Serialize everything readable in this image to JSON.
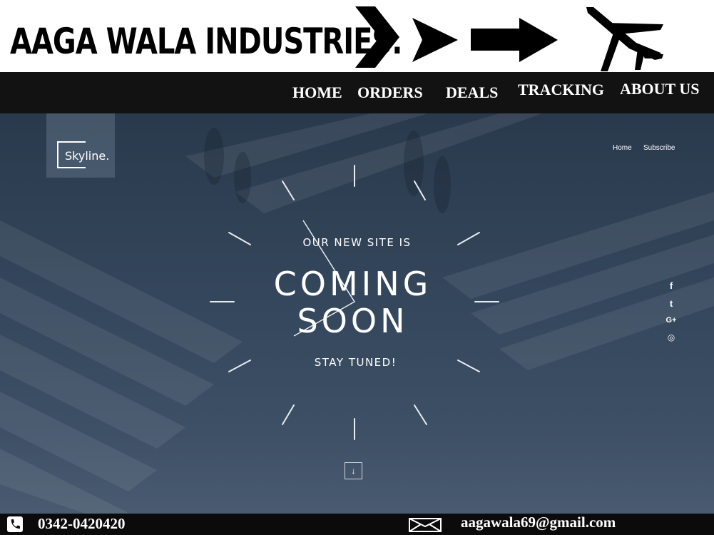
{
  "brand": {
    "title": "AAGA WALA INDUSTRIES.",
    "icons": [
      "chevron-right-icon",
      "chevron-right-icon",
      "arrow-right-icon",
      "airplane-icon"
    ]
  },
  "nav": {
    "items": [
      "HOME",
      "ORDERS",
      "DEALS",
      "TRACKING",
      "ABOUT US"
    ]
  },
  "hero": {
    "logo": "Skyline.",
    "links": [
      "Home",
      "Subscribe"
    ],
    "tagline": "OUR NEW SITE IS",
    "headline_1": "COMING",
    "headline_2": "SOON",
    "subline": "STAY TUNED!",
    "social_icons": [
      "facebook-icon",
      "twitter-icon",
      "google-plus-icon",
      "instagram-icon"
    ],
    "social_glyphs": [
      "f",
      "t",
      "G+",
      "◎"
    ],
    "scroll_glyph": "↓",
    "colors": {
      "overlay": "#34465b",
      "text": "#ffffff"
    }
  },
  "footer": {
    "phone": "0342-0420420",
    "email": "aagawala69@gmail.com",
    "icons": [
      "phone-icon",
      "envelope-icon"
    ]
  }
}
